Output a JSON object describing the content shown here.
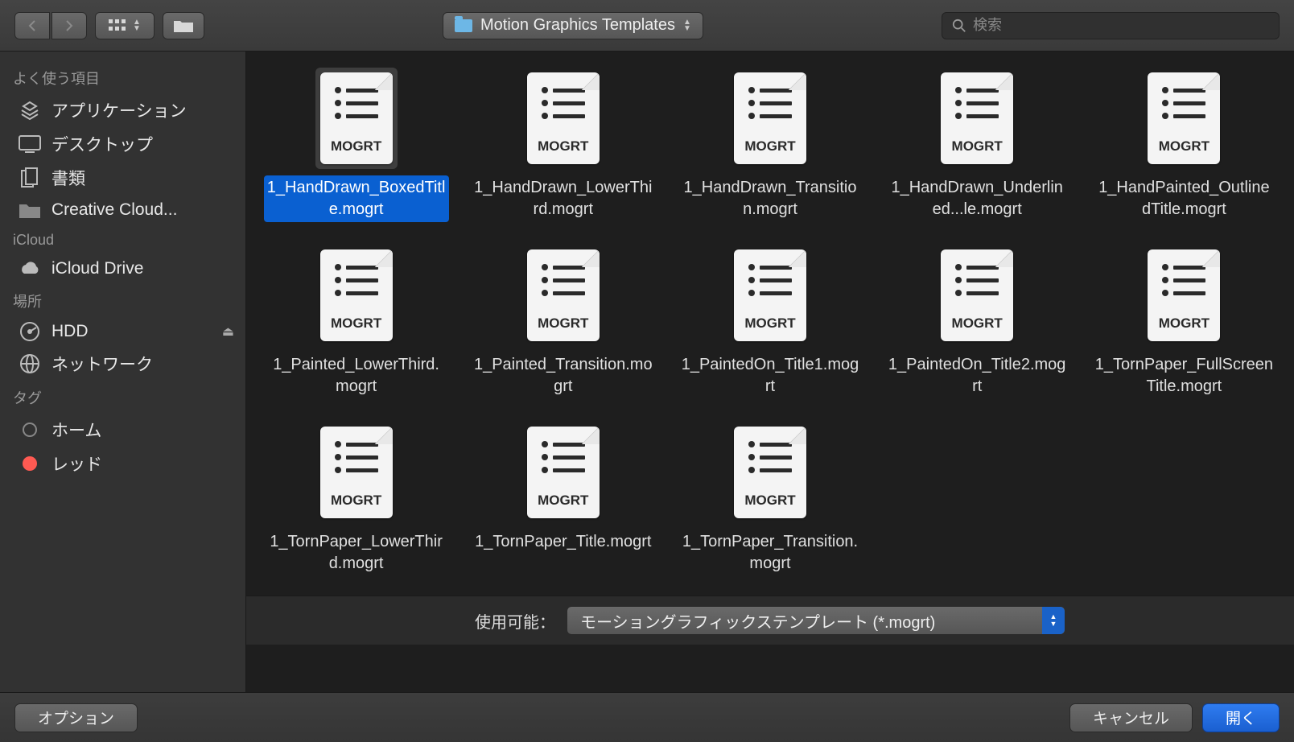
{
  "path": {
    "folder_name": "Motion Graphics Templates"
  },
  "search": {
    "placeholder": "検索"
  },
  "sidebar": {
    "sections": [
      {
        "header": "よく使う項目",
        "items": [
          {
            "label": "アプリケーション",
            "icon": "apps"
          },
          {
            "label": "デスクトップ",
            "icon": "desktop"
          },
          {
            "label": "書類",
            "icon": "docs"
          },
          {
            "label": "Creative Cloud...",
            "icon": "folder"
          }
        ]
      },
      {
        "header": "iCloud",
        "items": [
          {
            "label": "iCloud Drive",
            "icon": "cloud"
          }
        ]
      },
      {
        "header": "場所",
        "items": [
          {
            "label": "HDD",
            "icon": "hdd",
            "eject": true
          },
          {
            "label": "ネットワーク",
            "icon": "network"
          }
        ]
      },
      {
        "header": "タグ",
        "items": [
          {
            "label": "ホーム",
            "icon": "tag-empty"
          },
          {
            "label": "レッド",
            "icon": "tag-red"
          }
        ]
      }
    ]
  },
  "files": {
    "ext_label": "MOGRT",
    "items": [
      {
        "name": "1_HandDrawn_BoxedTitle.mogrt",
        "selected": true
      },
      {
        "name": "1_HandDrawn_LowerThird.mogrt"
      },
      {
        "name": "1_HandDrawn_Transition.mogrt"
      },
      {
        "name": "1_HandDrawn_Underlined...le.mogrt"
      },
      {
        "name": "1_HandPainted_OutlinedTitle.mogrt"
      },
      {
        "name": "1_Painted_LowerThird.mogrt"
      },
      {
        "name": "1_Painted_Transition.mogrt"
      },
      {
        "name": "1_PaintedOn_Title1.mogrt"
      },
      {
        "name": "1_PaintedOn_Title2.mogrt"
      },
      {
        "name": "1_TornPaper_FullScreenTitle.mogrt"
      },
      {
        "name": "1_TornPaper_LowerThird.mogrt"
      },
      {
        "name": "1_TornPaper_Title.mogrt"
      },
      {
        "name": "1_TornPaper_Transition.mogrt"
      }
    ]
  },
  "filter": {
    "label": "使用可能：",
    "value": "モーショングラフィックステンプレート (*.mogrt)"
  },
  "footer": {
    "options": "オプション",
    "cancel": "キャンセル",
    "open": "開く"
  }
}
